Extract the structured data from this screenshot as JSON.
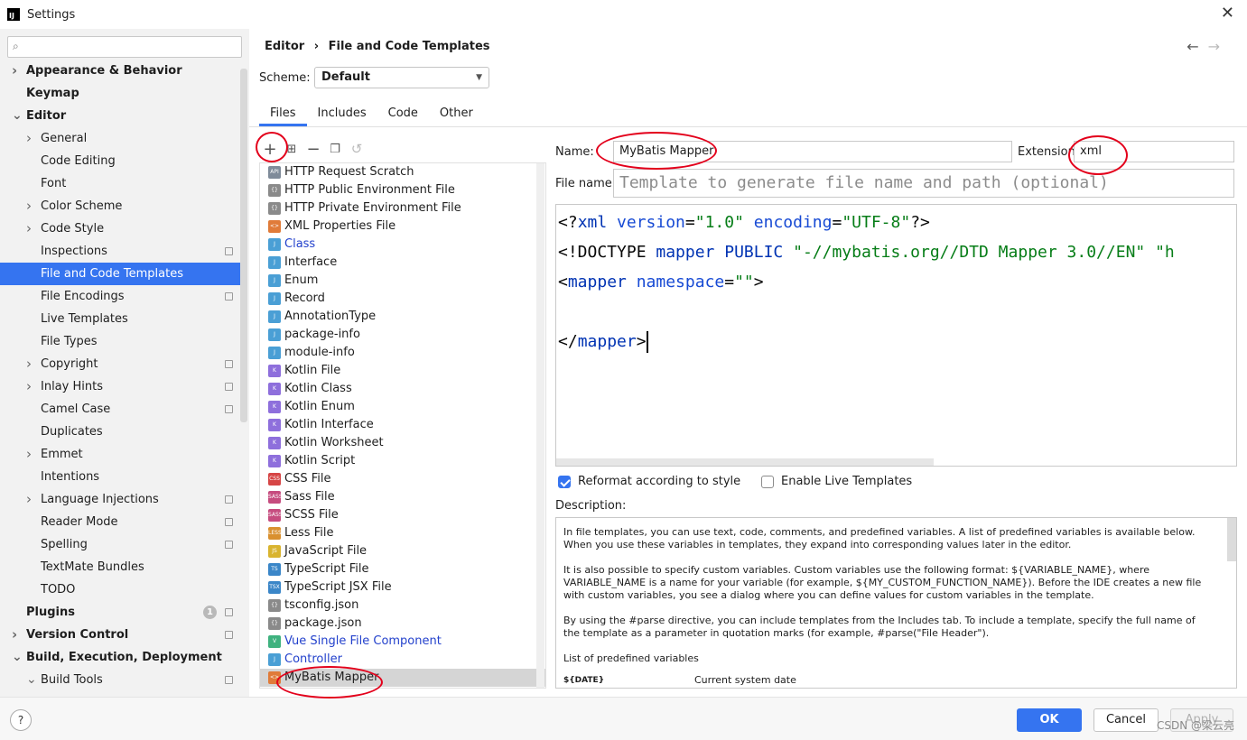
{
  "window": {
    "title": "Settings",
    "logo_text": "IJ"
  },
  "sidebar": {
    "search_placeholder": "",
    "items": [
      {
        "label": "Appearance & Behavior",
        "level": 0,
        "bold": true,
        "chevron": "right"
      },
      {
        "label": "Keymap",
        "level": 0,
        "bold": true
      },
      {
        "label": "Editor",
        "level": 0,
        "bold": true,
        "chevron": "down"
      },
      {
        "label": "General",
        "level": 1,
        "chevron": "right"
      },
      {
        "label": "Code Editing",
        "level": 1
      },
      {
        "label": "Font",
        "level": 1
      },
      {
        "label": "Color Scheme",
        "level": 1,
        "chevron": "right"
      },
      {
        "label": "Code Style",
        "level": 1,
        "chevron": "right"
      },
      {
        "label": "Inspections",
        "level": 1,
        "settings_icon": true
      },
      {
        "label": "File and Code Templates",
        "level": 1,
        "selected": true
      },
      {
        "label": "File Encodings",
        "level": 1,
        "settings_icon": true
      },
      {
        "label": "Live Templates",
        "level": 1
      },
      {
        "label": "File Types",
        "level": 1
      },
      {
        "label": "Copyright",
        "level": 1,
        "chevron": "right",
        "settings_icon": true
      },
      {
        "label": "Inlay Hints",
        "level": 1,
        "chevron": "right",
        "settings_icon": true
      },
      {
        "label": "Camel Case",
        "level": 1,
        "settings_icon": true
      },
      {
        "label": "Duplicates",
        "level": 1
      },
      {
        "label": "Emmet",
        "level": 1,
        "chevron": "right"
      },
      {
        "label": "Intentions",
        "level": 1
      },
      {
        "label": "Language Injections",
        "level": 1,
        "chevron": "right",
        "settings_icon": true
      },
      {
        "label": "Reader Mode",
        "level": 1,
        "settings_icon": true
      },
      {
        "label": "Spelling",
        "level": 1,
        "settings_icon": true
      },
      {
        "label": "TextMate Bundles",
        "level": 1
      },
      {
        "label": "TODO",
        "level": 1
      },
      {
        "label": "Plugins",
        "level": 0,
        "bold": true,
        "badge": "1",
        "settings_icon": true
      },
      {
        "label": "Version Control",
        "level": 0,
        "bold": true,
        "chevron": "right",
        "settings_icon": true
      },
      {
        "label": "Build, Execution, Deployment",
        "level": 0,
        "bold": true,
        "chevron": "down"
      },
      {
        "label": "Build Tools",
        "level": 1,
        "chevron": "down",
        "settings_icon": true
      }
    ]
  },
  "breadcrumb": {
    "parent": "Editor",
    "separator": "›",
    "current": "File and Code Templates"
  },
  "scheme": {
    "label": "Scheme:",
    "value": "Default"
  },
  "tabs": [
    {
      "label": "Files",
      "active": true
    },
    {
      "label": "Includes"
    },
    {
      "label": "Code"
    },
    {
      "label": "Other"
    }
  ],
  "templates": [
    {
      "label": "HTTP Request Scratch",
      "icon": "API",
      "color": "#7f8b99"
    },
    {
      "label": "HTTP Public Environment File",
      "icon": "{}",
      "color": "#8a8a8a"
    },
    {
      "label": "HTTP Private Environment File",
      "icon": "{}",
      "color": "#8a8a8a"
    },
    {
      "label": "XML Properties File",
      "icon": "<>",
      "color": "#e07b39"
    },
    {
      "label": "Class",
      "icon": "J",
      "color": "#4a9fd5",
      "blue": true
    },
    {
      "label": "Interface",
      "icon": "J",
      "color": "#4a9fd5"
    },
    {
      "label": "Enum",
      "icon": "J",
      "color": "#4a9fd5"
    },
    {
      "label": "Record",
      "icon": "J",
      "color": "#4a9fd5"
    },
    {
      "label": "AnnotationType",
      "icon": "J",
      "color": "#4a9fd5"
    },
    {
      "label": "package-info",
      "icon": "J",
      "color": "#4a9fd5"
    },
    {
      "label": "module-info",
      "icon": "J",
      "color": "#4a9fd5"
    },
    {
      "label": "Kotlin File",
      "icon": "K",
      "color": "#8e6fdc"
    },
    {
      "label": "Kotlin Class",
      "icon": "K",
      "color": "#8e6fdc"
    },
    {
      "label": "Kotlin Enum",
      "icon": "K",
      "color": "#8e6fdc"
    },
    {
      "label": "Kotlin Interface",
      "icon": "K",
      "color": "#8e6fdc"
    },
    {
      "label": "Kotlin Worksheet",
      "icon": "K",
      "color": "#8e6fdc"
    },
    {
      "label": "Kotlin Script",
      "icon": "K",
      "color": "#8e6fdc"
    },
    {
      "label": "CSS File",
      "icon": "CSS",
      "color": "#d64545"
    },
    {
      "label": "Sass File",
      "icon": "SASS",
      "color": "#c64c7f"
    },
    {
      "label": "SCSS File",
      "icon": "SASS",
      "color": "#c64c7f"
    },
    {
      "label": "Less File",
      "icon": "LESS",
      "color": "#d9902f"
    },
    {
      "label": "JavaScript File",
      "icon": "JS",
      "color": "#d9b42f"
    },
    {
      "label": "TypeScript File",
      "icon": "TS",
      "color": "#3a86c8"
    },
    {
      "label": "TypeScript JSX File",
      "icon": "TSX",
      "color": "#3a86c8"
    },
    {
      "label": "tsconfig.json",
      "icon": "{}",
      "color": "#8a8a8a"
    },
    {
      "label": "package.json",
      "icon": "{}",
      "color": "#8a8a8a"
    },
    {
      "label": "Vue Single File Component",
      "icon": "V",
      "color": "#3fb27f",
      "blue": true
    },
    {
      "label": "Controller",
      "icon": "J",
      "color": "#4a9fd5",
      "blue": true
    },
    {
      "label": "MyBatis Mapper",
      "icon": "<>",
      "color": "#e07b39",
      "selected": true
    }
  ],
  "form": {
    "name_label": "Name:",
    "name_value": "MyBatis Mapper",
    "extension_label": "Extension:",
    "extension_value": "xml",
    "filename_label": "File name:",
    "filename_placeholder": "Template to generate file name and path (optional)"
  },
  "code": {
    "line1": {
      "a": "<?",
      "b": "xml",
      "c": " version",
      "d": "=",
      "e": "\"1.0\"",
      "f": " encoding",
      "g": "=",
      "h": "\"UTF-8\"",
      "i": "?>"
    },
    "line2": {
      "a": "<!DOCTYPE ",
      "b": "mapper",
      "c": " PUBLIC ",
      "d": "\"-//mybatis.org//DTD Mapper 3.0//EN\"",
      "e": " \"h"
    },
    "line3": {
      "a": "<",
      "b": "mapper",
      "c": " namespace",
      "d": "=",
      "e": "\"\"",
      "f": ">"
    },
    "line5": {
      "a": "</",
      "b": "mapper",
      "c": ">"
    }
  },
  "options": {
    "reformat": {
      "label": "Reformat according to style",
      "checked": true
    },
    "live": {
      "label": "Enable Live Templates",
      "checked": false
    }
  },
  "description": {
    "label": "Description:",
    "p1": "In file templates, you can use text, code, comments, and predefined variables. A list of predefined variables is available below. When you use these variables in templates, they expand into corresponding values later in the editor.",
    "p2": "It is also possible to specify custom variables. Custom variables use the following format: ${VARIABLE_NAME}, where VARIABLE_NAME is a name for your variable (for example, ${MY_CUSTOM_FUNCTION_NAME}). Before the IDE creates a new file with custom variables, you see a dialog where you can define values for custom variables in the template.",
    "p3": "By using the #parse directive, you can include templates from the Includes tab. To include a template, specify the full name of the template as a parameter in quotation marks (for example, #parse(\"File Header\").",
    "p4": "List of predefined variables",
    "var_name": "${DATE}",
    "var_desc": "Current system date"
  },
  "buttons": {
    "help": "?",
    "ok": "OK",
    "cancel": "Cancel",
    "apply": "Apply"
  },
  "watermark": "CSDN @梁云亮",
  "colors": {
    "accent": "#3574f0",
    "annotation": "#e3001b"
  }
}
